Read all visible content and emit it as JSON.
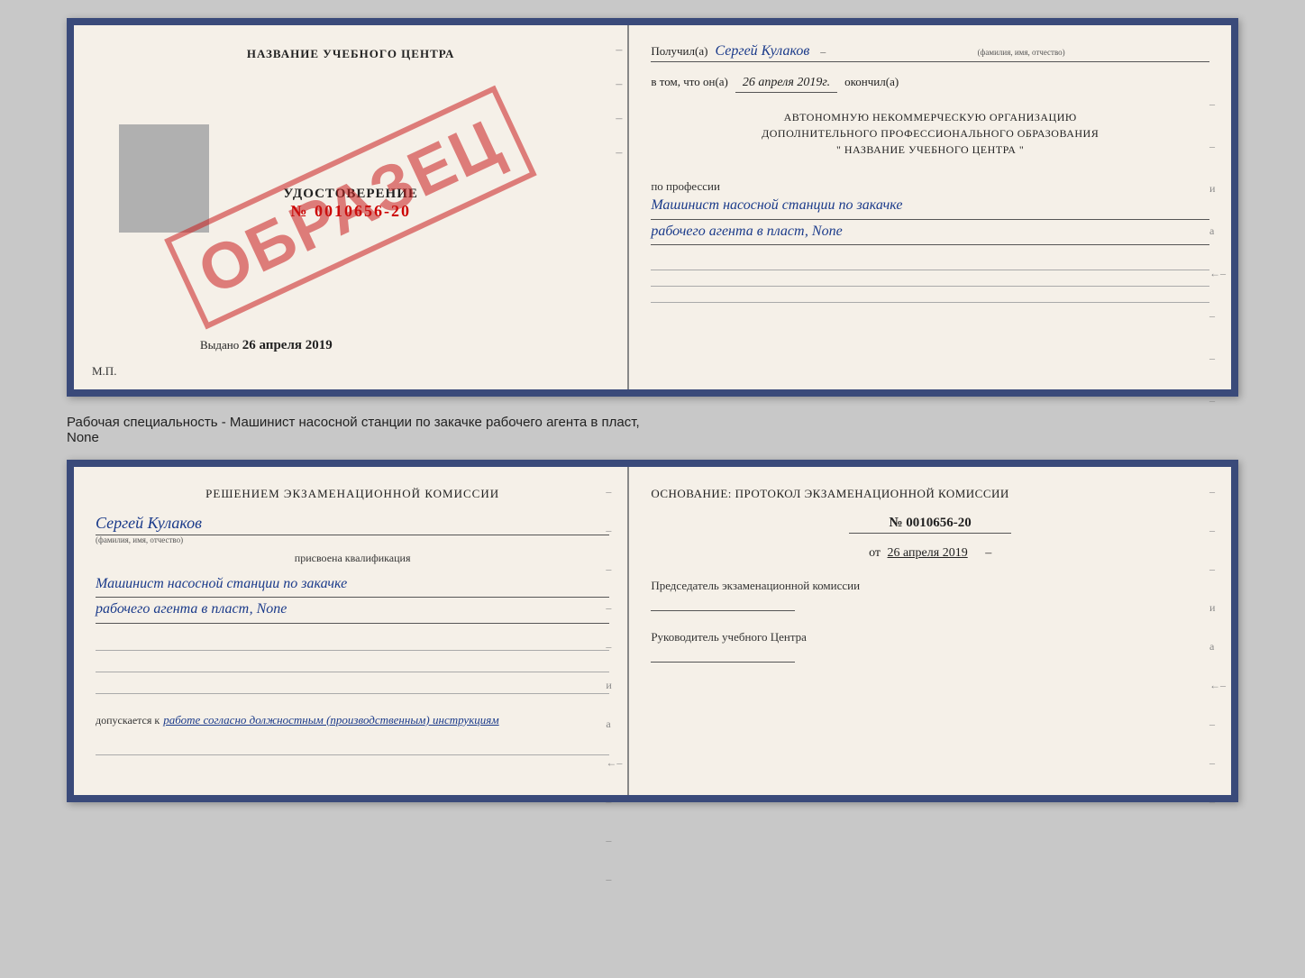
{
  "top_doc": {
    "left": {
      "center_title": "НАЗВАНИЕ УЧЕБНОГО ЦЕНТРА",
      "stamp_text": "ОБРАЗЕЦ",
      "udostoverenie_label": "УДОСТОВЕРЕНИЕ",
      "udostoverenie_num": "№ 0010656-20",
      "vydano_label": "Выдано",
      "vydano_date": "26 апреля 2019",
      "mp_label": "М.П."
    },
    "right": {
      "poluchil_label": "Получил(а)",
      "poluchil_value": "Сергей Кулаков",
      "familiya_label": "(фамилия, имя, отчество)",
      "vtom_label": "в том, что он(а)",
      "vtom_date": "26 апреля 2019г.",
      "okonchil_label": "окончил(а)",
      "org_line1": "АВТОНОМНУЮ НЕКОММЕРЧЕСКУЮ ОРГАНИЗАЦИЮ",
      "org_line2": "ДОПОЛНИТЕЛЬНОГО ПРОФЕССИОНАЛЬНОГО ОБРАЗОВАНИЯ",
      "org_line3": "\"   НАЗВАНИЕ УЧЕБНОГО ЦЕНТРА   \"",
      "po_professii_label": "по профессии",
      "profession_line1": "Машинист насосной станции по закачке",
      "profession_line2": "рабочего агента в пласт, None"
    }
  },
  "subtitle": "Рабочая специальность - Машинист насосной станции по закачке рабочего агента в пласт,",
  "subtitle2": "None",
  "bottom_doc": {
    "left": {
      "komissia_title": "Решением экзаменационной комиссии",
      "person_name": "Сергей Кулаков",
      "familiya_label": "(фамилия, имя, отчество)",
      "prisvoena_label": "присвоена квалификация",
      "kvalif_line1": "Машинист насосной станции по закачке",
      "kvalif_line2": "рабочего агента в пласт, None",
      "dopusk_label": "допускается к",
      "dopusk_value": "работе согласно должностным (производственным) инструкциям"
    },
    "right": {
      "osnovanie_label": "Основание: протокол экзаменационной комиссии",
      "protokol_num": "№ 0010656-20",
      "date_ot_label": "от",
      "date_ot_value": "26 апреля 2019",
      "predsedatel_label": "Председатель экзаменационной комиссии",
      "rukovoditel_label": "Руководитель учебного Центра"
    }
  }
}
